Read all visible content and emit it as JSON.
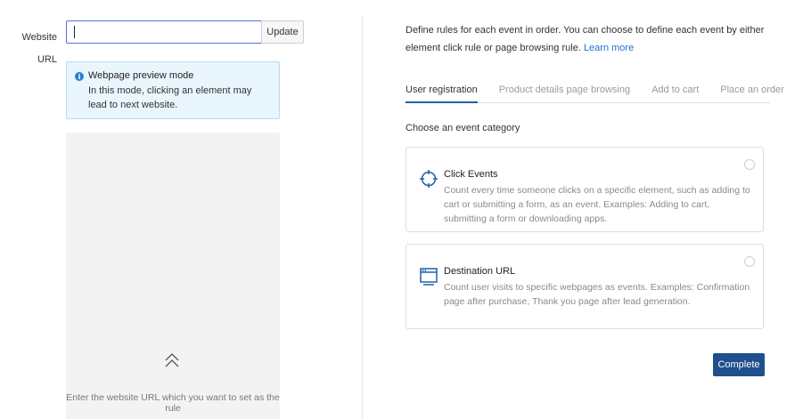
{
  "left": {
    "url_label": "Website URL",
    "url_value": "",
    "update_label": "Update",
    "notice": {
      "title": "Webpage preview mode",
      "body": "In this mode, clicking an element may lead to next website."
    },
    "preview_hint": "Enter the website URL which you want to set as the rule"
  },
  "right": {
    "description": "Define rules for each event in order. You can choose to define each event by either element click rule or page browsing rule.",
    "learn_more": "Learn more",
    "tabs": [
      {
        "label": "User registration",
        "active": true
      },
      {
        "label": "Product details page browsing",
        "active": false
      },
      {
        "label": "Add to cart",
        "active": false
      },
      {
        "label": "Place an order",
        "active": false
      }
    ],
    "category_label": "Choose an event category",
    "cards": [
      {
        "title": "Click Events",
        "description": "Count every time someone clicks on a specific element, such as adding to cart or submitting a form, as an event. Examples: Adding to cart, submitting a form or downloading apps.",
        "icon": "crosshair-icon",
        "selected": false
      },
      {
        "title": "Destination URL",
        "description": "Count user visits to specific webpages as events. Examples: Confirmation page after purchase, Thank you page after lead generation.",
        "icon": "browser-window-icon",
        "selected": false
      }
    ],
    "complete_label": "Complete"
  },
  "colors": {
    "primary": "#1f4f8c",
    "link": "#1f6fd1",
    "notice_bg": "#eaf6fd",
    "icon_blue": "#1f5fae"
  }
}
